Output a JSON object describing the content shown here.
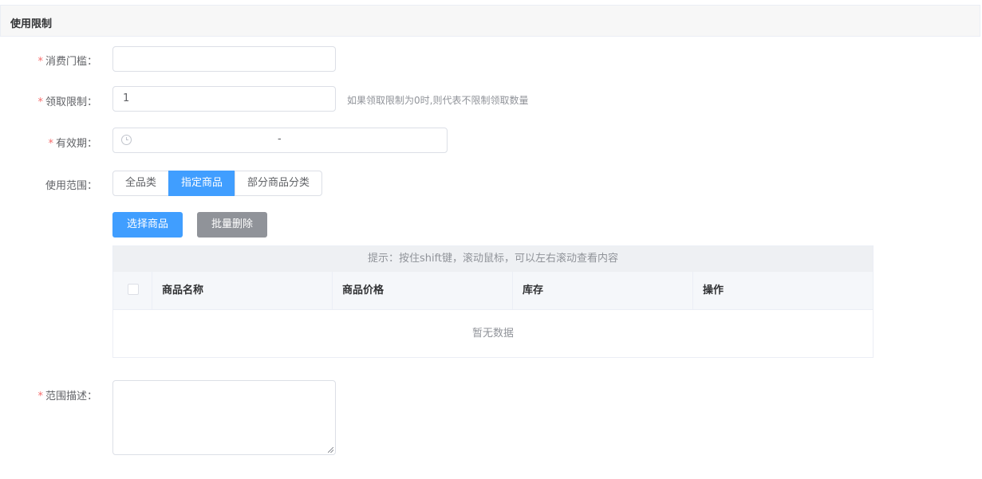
{
  "section": {
    "title": "使用限制"
  },
  "form": {
    "threshold": {
      "label": "消费门槛：",
      "value": ""
    },
    "limit": {
      "label": "领取限制：",
      "value": "1",
      "hint": "如果领取限制为0时,则代表不限制领取数量"
    },
    "validity": {
      "label": "有效期：",
      "separator": "-"
    },
    "scope": {
      "label": "使用范围：",
      "options": [
        "全品类",
        "指定商品",
        "部分商品分类"
      ],
      "selected": "指定商品"
    },
    "description": {
      "label": "范围描述：",
      "value": ""
    }
  },
  "actions": {
    "select_goods": "选择商品",
    "batch_delete": "批量删除"
  },
  "table": {
    "tip": "提示：按住shift键，滚动鼠标，可以左右滚动查看内容",
    "columns": [
      "商品名称",
      "商品价格",
      "库存",
      "操作"
    ],
    "empty_text": "暂无数据"
  },
  "colors": {
    "primary": "#409eff",
    "required": "#f56c6c",
    "gray_button": "#909399"
  },
  "icons": {
    "date_prefix": "clock-icon"
  }
}
